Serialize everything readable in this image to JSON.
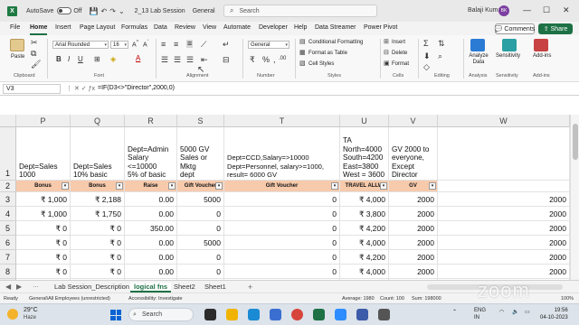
{
  "titlebar": {
    "autosave_label": "AutoSave",
    "autosave_state": "Off",
    "filename": "2_13 Lab Session",
    "general_label": "General",
    "search_placeholder": "Search",
    "user_name": "Balaji Kumar",
    "user_initials": "BK"
  },
  "ribbon_tabs": [
    "File",
    "Home",
    "Insert",
    "Page Layout",
    "Formulas",
    "Data",
    "Review",
    "View",
    "Automate",
    "Developer",
    "Help",
    "Data Streamer",
    "Power Pivot"
  ],
  "active_tab": "Home",
  "comments_label": "Comments",
  "share_label": "Share",
  "ribbon": {
    "paste_label": "Paste",
    "clipboard_label": "Clipboard",
    "font_name": "Arial Rounded",
    "font_size": "16",
    "font_label": "Font",
    "alignment_label": "Alignment",
    "number_format": "General",
    "number_label": "Number",
    "conditional_formatting": "Conditional Formatting",
    "format_as_table": "Format as Table",
    "cell_styles": "Cell Styles",
    "styles_label": "Styles",
    "insert_label": "Insert",
    "delete_label": "Delete",
    "format_label": "Format",
    "cells_label": "Cells",
    "editing_label": "Editing",
    "analyze_data": "Analyze Data",
    "analysis_label": "Analysis",
    "sensitivity_label": "Sensitivity",
    "addins_label": "Add-ins",
    "brand_color": "#1e7145"
  },
  "formula_bar": {
    "cell_ref": "V3",
    "formula": "=IF(D3<>\"Director\",2000,0)"
  },
  "columns": [
    "P",
    "Q",
    "R",
    "S",
    "T",
    "U",
    "V",
    "W"
  ],
  "row_numbers": [
    "1",
    "2",
    "3",
    "4",
    "5",
    "6",
    "7",
    "8",
    "9"
  ],
  "row1": {
    "P": "Dept=Sales\n1000",
    "Q": "Dept=Sales\n10% basic",
    "R": "Dept=Admin\nSalary\n<=10000\n5% of basic",
    "S": "5000 GV\nSales or Mktg\ndept",
    "T": "Dept=CCD,Salary=>10000\nDept=Personnel, salary>=1000,\nresult= 6000 GV",
    "U": "TA\nNorth=4000\nSouth=4200\nEast=3800\nWest = 3600",
    "V": "GV 2000 to\neveryone,\nExcept\nDirector"
  },
  "row2_headers": {
    "P": "Bonus",
    "Q": "Bonus",
    "R": "Raise",
    "S": "Gift Voucher",
    "T": "Gift Voucher",
    "U": "TRAVEL ALLW",
    "V": "GV"
  },
  "data_rows": [
    {
      "P": "₹ 1,000",
      "Q": "₹ 2,188",
      "R": "0.00",
      "S": "5000",
      "T": "0",
      "U": "₹   4,000",
      "V": "2000",
      "W": "2000"
    },
    {
      "P": "₹ 1,000",
      "Q": "₹ 1,750",
      "R": "0.00",
      "S": "0",
      "T": "0",
      "U": "₹   3,800",
      "V": "2000",
      "W": "2000"
    },
    {
      "P": "₹ 0",
      "Q": "₹ 0",
      "R": "350.00",
      "S": "0",
      "T": "0",
      "U": "₹   4,200",
      "V": "2000",
      "W": "2000"
    },
    {
      "P": "₹ 0",
      "Q": "₹ 0",
      "R": "0.00",
      "S": "5000",
      "T": "0",
      "U": "₹   4,000",
      "V": "2000",
      "W": "2000"
    },
    {
      "P": "₹ 0",
      "Q": "₹ 0",
      "R": "0.00",
      "S": "0",
      "T": "0",
      "U": "₹   4,200",
      "V": "2000",
      "W": "2000"
    },
    {
      "P": "₹ 0",
      "Q": "₹ 0",
      "R": "0.00",
      "S": "0",
      "T": "0",
      "U": "₹   4,000",
      "V": "2000",
      "W": "2000"
    },
    {
      "P": "₹ 0",
      "Q": "₹ 0",
      "R": "0.00",
      "S": "0",
      "T": "6000",
      "U": "₹   3,600",
      "V": "2000",
      "W": "2000"
    }
  ],
  "sheet_tabs": [
    "Lab Session_Description",
    "logical fns",
    "Sheet2",
    "Sheet1"
  ],
  "active_sheet": "logical fns",
  "status_bar": {
    "ready": "Ready",
    "sensitivity": "General\\All Employees (unrestricted)",
    "accessibility": "Accessibility: Investigate",
    "average": "Average: 1980",
    "count": "Count: 100",
    "sum": "Sum: 198000",
    "zoom": "100%"
  },
  "taskbar": {
    "temperature": "29°C",
    "weather": "Haze",
    "search": "Search",
    "lang": "ENG",
    "region": "IN",
    "time": "19:56",
    "date": "04-10-2023"
  },
  "watermark": "zoom"
}
